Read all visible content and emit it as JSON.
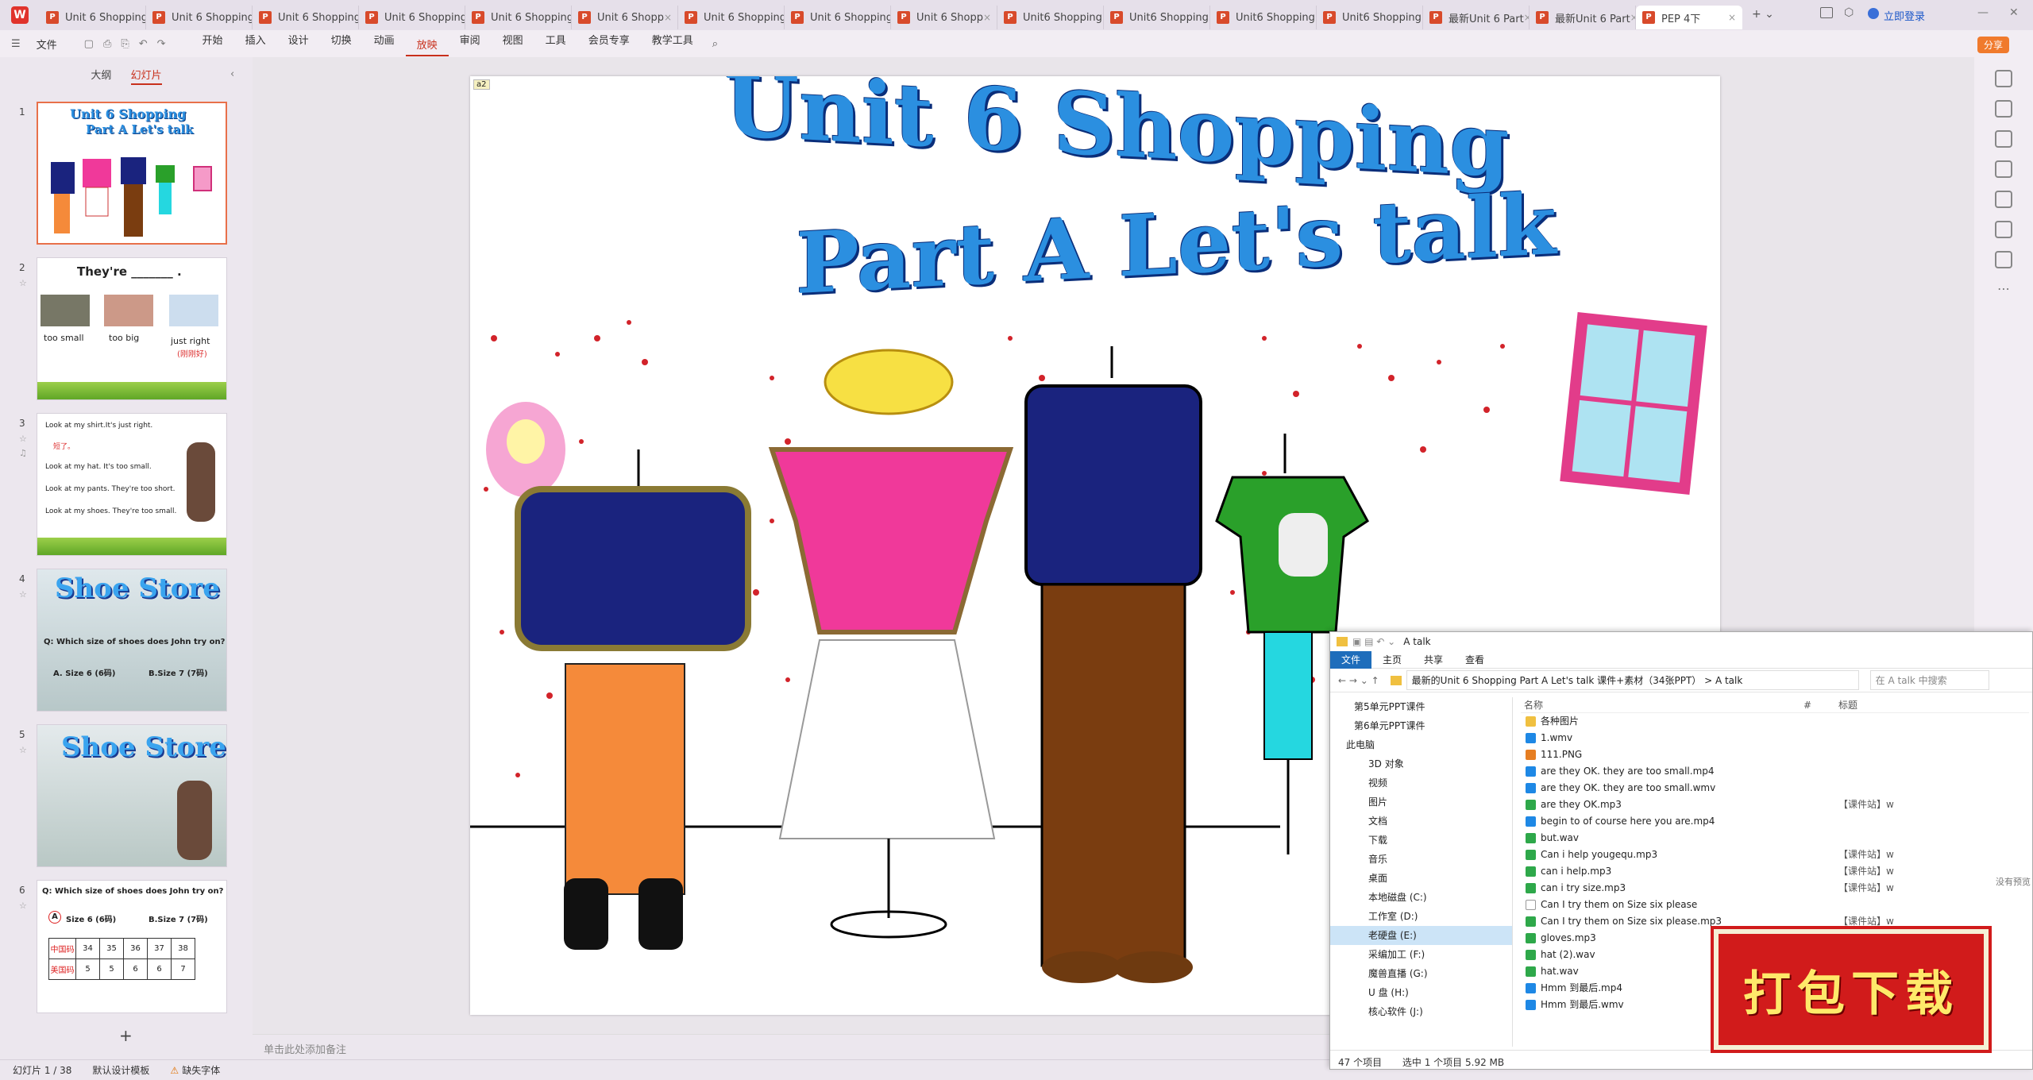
{
  "tabs": [
    {
      "label": "Unit 6 Shopping"
    },
    {
      "label": "Unit 6 Shopping"
    },
    {
      "label": "Unit 6 Shopping"
    },
    {
      "label": "Unit 6 Shopping"
    },
    {
      "label": "Unit 6 Shopping"
    },
    {
      "label": "Unit 6 Shopp"
    },
    {
      "label": "Unit 6 Shopping"
    },
    {
      "label": "Unit 6 Shopping"
    },
    {
      "label": "Unit 6 Shopp"
    },
    {
      "label": "Unit6 Shopping"
    },
    {
      "label": "Unit6 Shopping"
    },
    {
      "label": "Unit6 Shopping"
    },
    {
      "label": "Unit6 Shopping"
    },
    {
      "label": "最新Unit 6 Part"
    },
    {
      "label": "最新Unit 6 Part"
    },
    {
      "label": "PEP 4下"
    }
  ],
  "topright": {
    "login": "立即登录"
  },
  "menu": {
    "file": "文件",
    "items": [
      "开始",
      "插入",
      "设计",
      "切换",
      "动画",
      "放映",
      "审阅",
      "视图",
      "工具",
      "会员专享",
      "教学工具"
    ],
    "active": "放映",
    "share": "分享"
  },
  "panel": {
    "tab_outline": "大纲",
    "tab_slides": "幻灯片",
    "add": "+"
  },
  "thumbnails": [
    {
      "num": "1",
      "title1": "Unit 6 Shopping",
      "title2": "Part A Let's talk"
    },
    {
      "num": "2",
      "heading": "They're _______ .",
      "labels": [
        "too small",
        "too big",
        "just right"
      ],
      "sub": "(刚刚好)"
    },
    {
      "num": "3",
      "lines": [
        "Look at my shirt.It's just right.",
        "短了。",
        "Look at my hat. It's too small.",
        "Look at my pants. They're too short.",
        "Look at my shoes. They're too small."
      ]
    },
    {
      "num": "4",
      "title": "Shoe Store",
      "q": "Q: Which size of shoes does John try on?",
      "a": "A. Size 6 (6码)",
      "b": "B.Size 7 (7码)"
    },
    {
      "num": "5",
      "title": "Shoe Store"
    },
    {
      "num": "6",
      "q": "Q: Which size of shoes does John try on?",
      "a": "A",
      "a_rest": "Size 6 (6码)",
      "b": "B.Size 7 (7码)",
      "table_rows": [
        [
          "中国码",
          "34",
          "35",
          "36",
          "37",
          "38"
        ],
        [
          "美国码",
          "5",
          "5",
          "6",
          "6",
          "7"
        ]
      ]
    }
  ],
  "slide": {
    "badge": "a2",
    "title1": "Unit 6 Shopping",
    "title2": "Part A Let's talk"
  },
  "notes": {
    "placeholder": "单击此处添加备注"
  },
  "status": {
    "slide": "幻灯片 1 / 38",
    "template": "默认设计模板",
    "font": "缺失字体"
  },
  "explorer": {
    "title": "A talk",
    "ribbon": [
      "文件",
      "主页",
      "共享",
      "查看"
    ],
    "breadcrumb": "最新的Unit 6 Shopping Part A Let's talk 课件+素材（34张PPT）  >  A talk",
    "search_placeholder": "在 A talk 中搜索",
    "nav": [
      "第5单元PPT课件",
      "第6单元PPT课件",
      "此电脑",
      "3D 对象",
      "视频",
      "图片",
      "文档",
      "下载",
      "音乐",
      "桌面",
      "本地磁盘 (C:)",
      "工作室 (D:)",
      "老硬盘 (E:)",
      "采编加工 (F:)",
      "魔兽直播 (G:)",
      "U 盘 (H:)",
      "核心软件 (J:)"
    ],
    "headers": {
      "name": "名称",
      "num": "#",
      "title": "标题"
    },
    "files": [
      {
        "name": "各种图片",
        "tag": "",
        "type": "folder"
      },
      {
        "name": "1.wmv",
        "tag": "",
        "type": "video"
      },
      {
        "name": "111.PNG",
        "tag": "",
        "type": "image"
      },
      {
        "name": "are they OK. they are too small.mp4",
        "tag": "",
        "type": "video"
      },
      {
        "name": "are they OK. they are too small.wmv",
        "tag": "",
        "type": "video"
      },
      {
        "name": "are they OK.mp3",
        "tag": "【课件站】w",
        "type": "audio"
      },
      {
        "name": "begin to of course here you are.mp4",
        "tag": "",
        "type": "video"
      },
      {
        "name": "but.wav",
        "tag": "",
        "type": "audio"
      },
      {
        "name": "Can i help yougequ.mp3",
        "tag": "【课件站】w",
        "type": "audio"
      },
      {
        "name": "can i help.mp3",
        "tag": "【课件站】w",
        "type": "audio"
      },
      {
        "name": "can i try size.mp3",
        "tag": "【课件站】w",
        "type": "audio"
      },
      {
        "name": "Can I try them on  Size six please",
        "tag": "",
        "type": "doc"
      },
      {
        "name": "Can I try them on  Size six please.mp3",
        "tag": "【课件站】w",
        "type": "audio"
      },
      {
        "name": "gloves.mp3",
        "tag": "",
        "type": "audio"
      },
      {
        "name": "hat (2).wav",
        "tag": "",
        "type": "audio"
      },
      {
        "name": "hat.wav",
        "tag": "",
        "type": "audio"
      },
      {
        "name": "Hmm  到最后.mp4",
        "tag": "",
        "type": "video"
      },
      {
        "name": "Hmm  到最后.wmv",
        "tag": "",
        "type": "video"
      }
    ],
    "status_items": "47 个项目",
    "status_sel": "选中 1 个项目  5.92 MB",
    "no_preview": "没有预览"
  },
  "banner": {
    "text": "打包下载"
  },
  "colors": {
    "accent": "#c8301c",
    "tab_bg": "#e6e0ea",
    "title_blue": "#2b8fe0",
    "banner_red": "#d11b1b"
  }
}
